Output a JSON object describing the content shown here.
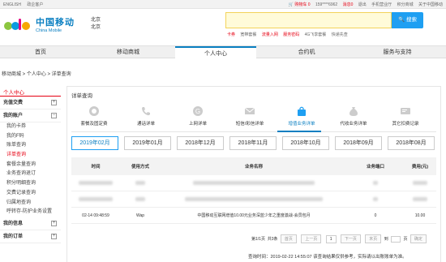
{
  "topbar": {
    "lang": "ENGLISH",
    "gov": "政企客户",
    "cart": "购物车 0",
    "phone": "159****6962",
    "msg": "消息0",
    "exit": "退出",
    "mobile_biz": "手机营业厅",
    "points": "积分商城",
    "about": "关于中国移动"
  },
  "header": {
    "brand_zh": "中国移动",
    "brand_en": "China Mobile",
    "city1": "北京",
    "city2": "北京",
    "search_button": "搜索",
    "hotlinks": [
      "卡券",
      "宽带套餐",
      "流量入网",
      "服务密码",
      "4G飞享套餐",
      "快递先查"
    ]
  },
  "nav": {
    "items": [
      "首页",
      "移动商城",
      "个人中心",
      "合约机",
      "服务与支持"
    ]
  },
  "breadcrumb": "移动商城 > 个人中心 > 详单查询",
  "sidebar": {
    "head": "个人中心",
    "groups": [
      {
        "label": "充值交费"
      },
      {
        "label": "我的账户"
      }
    ],
    "items": [
      "我的卡券",
      "我的F码",
      "账单查询",
      "详单查询",
      "套餐余量查询",
      "业务查询退订",
      "积分明细查询",
      "交费记录查询",
      "归属地查询",
      "呼转存-防护业务设置"
    ],
    "groups2": [
      {
        "label": "我的信息"
      },
      {
        "label": "我的订单"
      }
    ]
  },
  "page_title": "详单查询",
  "categories": [
    "套餐及固定费",
    "通话详单",
    "上网详单",
    "短信/彩信详单",
    "增值业务详单",
    "代收业务详单",
    "其它扣费记录"
  ],
  "months": [
    "2019年02月",
    "2019年01月",
    "2018年12月",
    "2018年11月",
    "2018年10月",
    "2018年09月",
    "2018年08月"
  ],
  "table": {
    "headers": [
      "时间",
      "使用方式",
      "业务名称",
      "业务端口",
      "费用(元)"
    ],
    "row": {
      "time": "02-14 09:48:59",
      "mode": "Wap",
      "name": "中国移动互联网增值10.00元业务深蓝少年之重度激战-会员包月",
      "port": "0",
      "fee": "10.00"
    }
  },
  "pager": {
    "info": "第1/1页",
    "total": "共3条",
    "first": "首页",
    "prev": "上一页",
    "page": "1",
    "next": "下一页",
    "last": "末页",
    "goto": "到",
    "unit": "页",
    "jump": "确定"
  },
  "footer_note": "查询时间：2019-02-22 14:55:07 该查询结果仅供参考，实际请以出账账单为准。"
}
